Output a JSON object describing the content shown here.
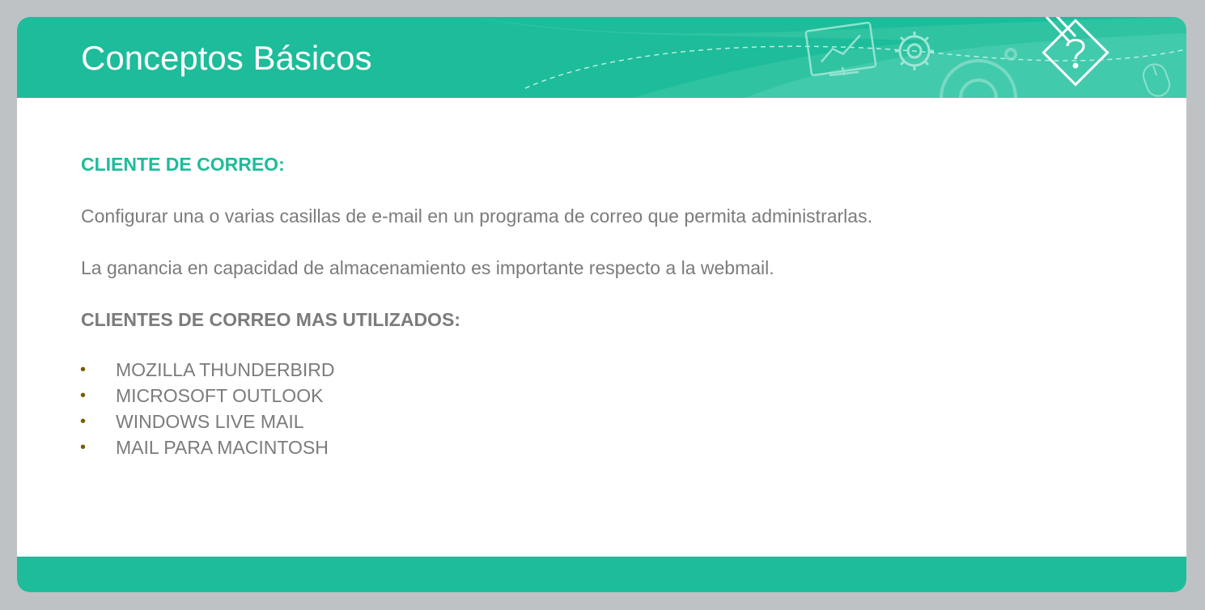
{
  "slide": {
    "title": "Conceptos Básicos",
    "section_heading": "CLIENTE DE CORREO:",
    "paragraphs": [
      "Configurar una o varias casillas de e-mail en un programa de correo que permita administrarlas.",
      "La ganancia en capacidad de almacenamiento es importante respecto a la webmail."
    ],
    "list_heading": "CLIENTES DE CORREO MAS UTILIZADOS:",
    "list_items": [
      "MOZILLA THUNDERBIRD",
      "MICROSOFT OUTLOOK",
      "WINDOWS LIVE MAIL",
      "MAIL PARA MACINTOSH"
    ],
    "bullet_glyph": "•"
  },
  "colors": {
    "accent": "#1dbc9a",
    "body_text": "#7b7b7b",
    "bullet": "#7a5c00",
    "background": "#bfc2c5"
  },
  "icons": [
    "monitor-chart-icon",
    "gear-icon",
    "large-gear-icon",
    "pencil-question-icon",
    "mouse-icon"
  ]
}
